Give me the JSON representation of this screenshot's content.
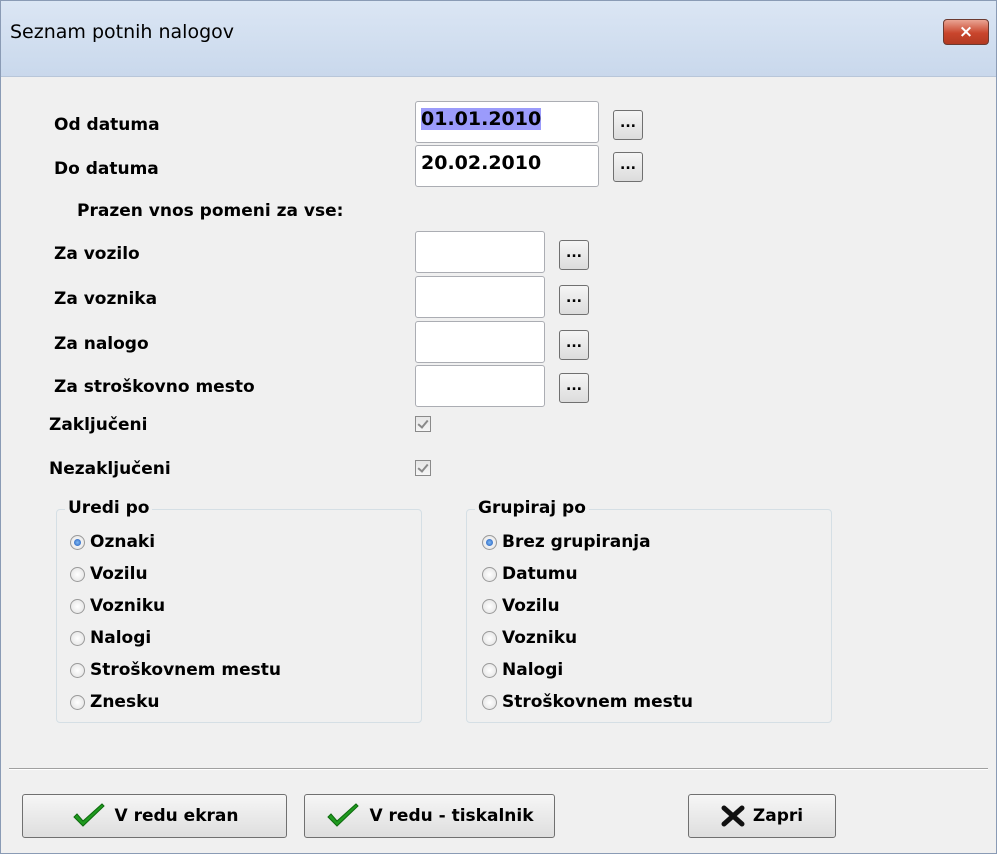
{
  "window": {
    "title": "Seznam potnih nalogov",
    "close_label": "×"
  },
  "fields": {
    "od_datuma": {
      "label": "Od datuma",
      "value": "01.01.2010"
    },
    "do_datuma": {
      "label": "Do datuma",
      "value": "20.02.2010"
    },
    "hint": "Prazen vnos pomeni za vse:",
    "za_vozilo": {
      "label": "Za vozilo",
      "value": ""
    },
    "za_voznika": {
      "label": "Za voznika",
      "value": ""
    },
    "za_nalogo": {
      "label": "Za nalogo",
      "value": ""
    },
    "za_stroskovno_mesto": {
      "label": "Za stroškovno mesto",
      "value": ""
    },
    "browse_label": "..."
  },
  "checkboxes": {
    "zakljuceni": {
      "label": "Zaključeni",
      "checked": true
    },
    "nezakljuceni": {
      "label": "Nezaključeni",
      "checked": true
    }
  },
  "sort_group": {
    "title": "Uredi po",
    "options": [
      "Oznaki",
      "Vozilu",
      "Vozniku",
      "Nalogi",
      "Stroškovnem mestu",
      "Znesku"
    ],
    "selected": "Oznaki"
  },
  "group_group": {
    "title": "Grupiraj po",
    "options": [
      "Brez grupiranja",
      "Datumu",
      "Vozilu",
      "Vozniku",
      "Nalogi",
      "Stroškovnem mestu"
    ],
    "selected": "Brez grupiranja"
  },
  "buttons": {
    "ok_screen": "V redu ekran",
    "ok_printer": "V redu - tiskalnik",
    "close": "Zapri"
  },
  "colors": {
    "selection": "#9b9bfb",
    "check_green": "#1f9a1f",
    "close_red": "#c9452c"
  }
}
